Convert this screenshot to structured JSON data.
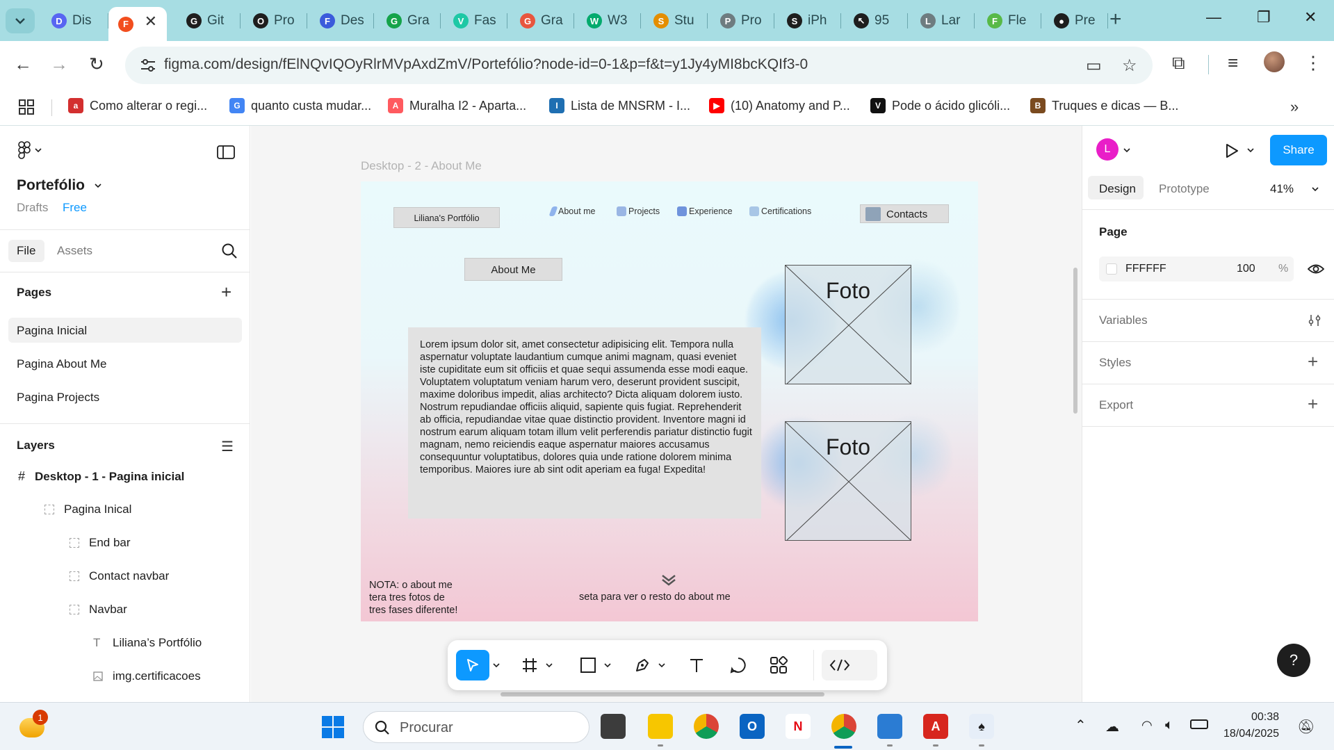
{
  "browser": {
    "tabs": [
      {
        "label": "Dis",
        "icon": "discord-icon",
        "color": "#5865f2",
        "glyph": "D"
      },
      {
        "label": "",
        "icon": "figma-icon",
        "color": "#f24e1e",
        "glyph": "F",
        "active": true
      },
      {
        "label": "Git",
        "icon": "github-icon",
        "color": "#1e1e1e",
        "glyph": "G"
      },
      {
        "label": "Pro",
        "icon": "openai-icon",
        "color": "#1e1e1e",
        "glyph": "O"
      },
      {
        "label": "Des",
        "icon": "docs-icon",
        "color": "#3b5bdb",
        "glyph": "F"
      },
      {
        "label": "Gra",
        "icon": "grammarly-icon",
        "color": "#15a34a",
        "glyph": "G"
      },
      {
        "label": "Fas",
        "icon": "vuetify-icon",
        "color": "#1ec8a5",
        "glyph": "V"
      },
      {
        "label": "Gra",
        "icon": "grammarly-alt-icon",
        "color": "#e8553e",
        "glyph": "G"
      },
      {
        "label": "W3",
        "icon": "w3schools-icon",
        "color": "#04aa6d",
        "glyph": "W"
      },
      {
        "label": "Stu",
        "icon": "mysql-icon",
        "color": "#e48e00",
        "glyph": "S"
      },
      {
        "label": "Pro",
        "icon": "globe-icon",
        "color": "#6e7c80",
        "glyph": "P"
      },
      {
        "label": "iPh",
        "icon": "s-icon",
        "color": "#1e1e1e",
        "glyph": "S"
      },
      {
        "label": "95",
        "icon": "cursor-icon",
        "color": "#1e1e1e",
        "glyph": "↖"
      },
      {
        "label": "Lar",
        "icon": "globe-icon",
        "color": "#6e7c80",
        "glyph": "L"
      },
      {
        "label": "Fle",
        "icon": "frog-icon",
        "color": "#58b947",
        "glyph": "F"
      },
      {
        "label": "Pre",
        "icon": "record-icon",
        "color": "#1e1e1e",
        "glyph": "●"
      }
    ],
    "url": "figma.com/design/fElNQvIQOyRlrMVpAxdZmV/Portefólio?node-id=0-1&p=f&t=y1Jy4yMI8bcKQIf3-0",
    "bookmarks": [
      {
        "label": "Como alterar o regi...",
        "icon": "acp-icon",
        "color": "#d32f2f",
        "glyph": "a"
      },
      {
        "label": "quanto custa mudar...",
        "icon": "google-icon",
        "color": "#4285f4",
        "glyph": "G"
      },
      {
        "label": "Muralha I2 - Aparta...",
        "icon": "airbnb-icon",
        "color": "#ff5a5f",
        "glyph": "A"
      },
      {
        "label": "Lista de MNSRM - I...",
        "icon": "infarmed-icon",
        "color": "#1f6fb2",
        "glyph": "I"
      },
      {
        "label": "(10) Anatomy and P...",
        "icon": "youtube-icon",
        "color": "#ff0000",
        "glyph": "▶"
      },
      {
        "label": "Pode o ácido glicóli...",
        "icon": "v-icon",
        "color": "#111111",
        "glyph": "V"
      },
      {
        "label": "Truques e dicas — B...",
        "icon": "bf-icon",
        "color": "#7a4a1f",
        "glyph": "B"
      }
    ]
  },
  "figma": {
    "file_name": "Portefólio",
    "drafts": "Drafts",
    "plan": "Free",
    "tabs": {
      "file": "File",
      "assets": "Assets"
    },
    "pages_title": "Pages",
    "pages": [
      "Pagina Inicial",
      "Pagina About Me",
      "Pagina Projects"
    ],
    "layers_title": "Layers",
    "layers": [
      {
        "label": "Desktop - 1 - Pagina inicial",
        "type": "frame",
        "indent": 0
      },
      {
        "label": "Pagina Inical",
        "type": "group",
        "indent": 1
      },
      {
        "label": "End bar",
        "type": "group",
        "indent": 2
      },
      {
        "label": "Contact navbar",
        "type": "group",
        "indent": 2
      },
      {
        "label": "Navbar",
        "type": "group",
        "indent": 2
      },
      {
        "label": "Liliana’s Portfólio",
        "type": "text",
        "indent": 3
      },
      {
        "label": "img.certificacoes",
        "type": "image",
        "indent": 3
      }
    ],
    "frame": {
      "label": "Desktop - 2 - About Me",
      "portfolio_title": "Liliana's Portfólio",
      "nav": [
        "About me",
        "Projects",
        "Experience",
        "Certifications"
      ],
      "contacts": "Contacts",
      "about_button": "About Me",
      "foto_label": "Foto",
      "lorem": "Lorem ipsum dolor sit, amet consectetur adipisicing elit. Tempora nulla aspernatur voluptate laudantium cumque animi magnam, quasi eveniet iste cupiditate eum sit officiis et quae sequi assumenda esse modi eaque. Voluptatem voluptatum veniam harum vero, deserunt provident suscipit, maxime doloribus impedit, alias architecto? Dicta aliquam dolorem iusto. Nostrum repudiandae officiis aliquid, sapiente quis fugiat. Reprehenderit ab officia, repudiandae vitae quae distinctio provident. Inventore magni id nostrum earum aliquam totam illum velit perferendis pariatur distinctio fugit magnam, nemo reiciendis eaque aspernatur maiores accusamus consequuntur voluptatibus, dolores quia unde ratione dolorem minima temporibus. Maiores iure ab sint odit aperiam ea fuga! Expedita!",
      "note": [
        "NOTA: o about me",
        "tera tres fotos de",
        "tres fases diferente!"
      ],
      "arrow_caption": "seta para ver o resto do about me"
    },
    "right_panel": {
      "avatar_letter": "L",
      "share": "Share",
      "tabs": {
        "design": "Design",
        "prototype": "Prototype"
      },
      "zoom": "41%",
      "page_title": "Page",
      "page_color": "FFFFFF",
      "page_opacity": "100",
      "percent": "%",
      "sections": [
        "Variables",
        "Styles",
        "Export"
      ],
      "help": "?"
    }
  },
  "taskbar": {
    "weather_badge": "1",
    "search_placeholder": "Procurar",
    "time": "00:38",
    "date": "18/04/2025"
  },
  "colors": {
    "accent_blue": "#0d99ff",
    "avatar_pink": "#e91ec8",
    "browser_frame": "#a7dde3"
  }
}
